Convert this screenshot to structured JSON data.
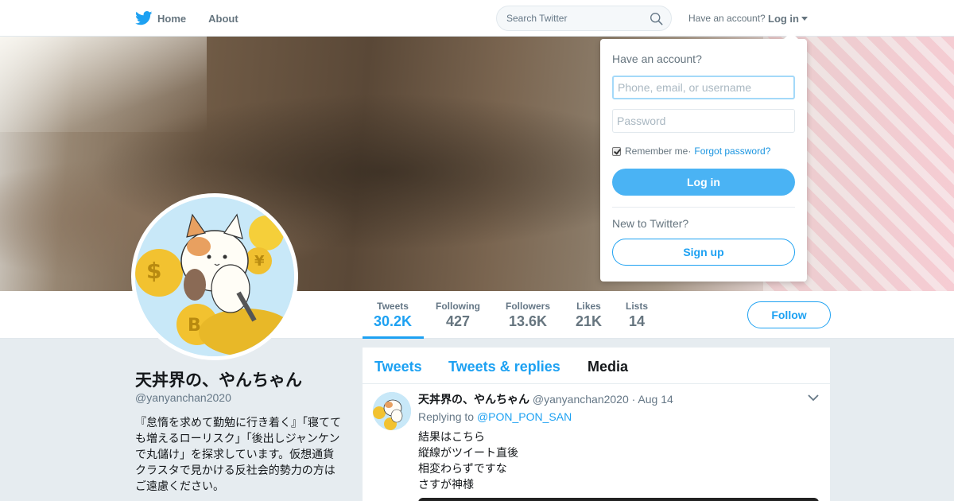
{
  "nav": {
    "home_label": "Home",
    "about_label": "About",
    "search_placeholder": "Search Twitter",
    "have_account": "Have an account?",
    "login_label": "Log in"
  },
  "profile": {
    "name": "天丼界の、やんちゃん",
    "handle": "@yanyanchan2020",
    "bio": "『怠惰を求めて勤勉に行き着く』「寝てても増えるローリスク」「後出しジャンケンで丸儲け」を探求しています。仮想通貨クラスタで見かける反社会的勢力の方はご遠慮ください。",
    "follow_label": "Follow"
  },
  "stats": [
    {
      "label": "Tweets",
      "value": "30.2K",
      "active": true
    },
    {
      "label": "Following",
      "value": "427",
      "active": false
    },
    {
      "label": "Followers",
      "value": "13.6K",
      "active": false
    },
    {
      "label": "Likes",
      "value": "21K",
      "active": false
    },
    {
      "label": "Lists",
      "value": "14",
      "active": false
    }
  ],
  "timeline": {
    "tabs": [
      {
        "label": "Tweets",
        "current": false
      },
      {
        "label": "Tweets & replies",
        "current": false
      },
      {
        "label": "Media",
        "current": true
      }
    ],
    "tweet": {
      "name": "天丼界の、やんちゃん",
      "meta": " @yanyanchan2020 · Aug 14",
      "replying_prefix": "Replying to ",
      "replying_to": "@PON_PON_SAN",
      "lines": [
        "結果はこちら",
        "縦線がツイート直後",
        "相変わらずですな",
        "さすが神様"
      ]
    }
  },
  "login_dropdown": {
    "title": "Have an account?",
    "username_placeholder": "Phone, email, or username",
    "password_placeholder": "Password",
    "remember_label": "Remember me",
    "separator": " · ",
    "forgot_label": "Forgot password?",
    "login_button": "Log in",
    "new_label": "New to Twitter?",
    "signup_button": "Sign up"
  },
  "colors": {
    "accent": "#1da1f2",
    "login_button": "#4ab3f4",
    "background": "#e6ecf0"
  },
  "icons": [
    "twitter-bird-icon",
    "search-icon",
    "caret-down-icon",
    "chevron-down-icon",
    "checkbox-checked-icon"
  ]
}
